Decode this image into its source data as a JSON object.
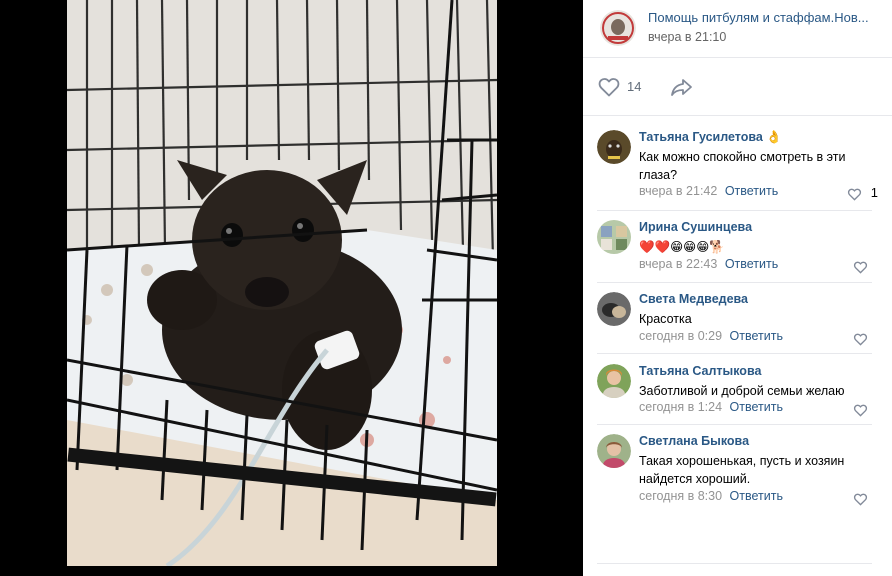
{
  "post": {
    "author": "Помощь питбулям и стаффам.Нов...",
    "time": "вчера в 21:10",
    "likes": "14"
  },
  "comments": [
    {
      "name": "Татьяна Гусилетова 👌",
      "text": "Как можно спокойно смотреть в эти глаза?",
      "time": "вчера в 21:42",
      "reply": "Ответить",
      "likes": "1"
    },
    {
      "name": "Ирина Сушинцева",
      "text": "❤️❤️😁😁😁🐕",
      "time": "вчера в 22:43",
      "reply": "Ответить",
      "likes": ""
    },
    {
      "name": "Света Медведева",
      "text": "Красотка",
      "time": "сегодня в 0:29",
      "reply": "Ответить",
      "likes": ""
    },
    {
      "name": "Татьяна Салтыкова",
      "text": "Заботливой и доброй семьи желаю",
      "time": "сегодня в 1:24",
      "reply": "Ответить",
      "likes": ""
    },
    {
      "name": "Светлана Быкова",
      "text": "Такая хорошенькая, пусть и хозяин найдется хороший.",
      "time": "сегодня в 8:30",
      "reply": "Ответить",
      "likes": ""
    }
  ],
  "colors": {
    "link": "#2a5885",
    "meta": "#939393",
    "icon": "#828a99"
  },
  "icons": [
    "heart-outline-icon",
    "share-arrow-icon"
  ]
}
